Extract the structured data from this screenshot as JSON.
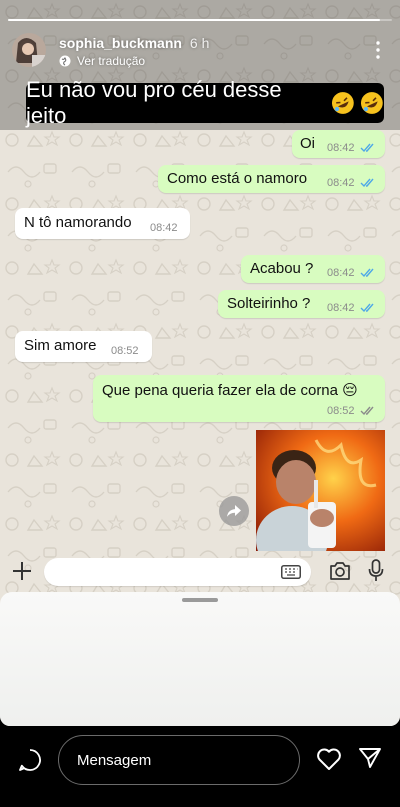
{
  "story": {
    "username": "sophia_buckmann",
    "time_ago": "6 h",
    "translate_label": "Ver tradução",
    "caption": "Eu não vou pro céu desse jeito",
    "progress": 0.97
  },
  "chat": {
    "messages": [
      {
        "text": "Oi",
        "time": "08:42",
        "side": "out",
        "status": "read"
      },
      {
        "text": "Como está o namoro",
        "time": "08:42",
        "side": "out",
        "status": "read"
      },
      {
        "text": "N tô namorando",
        "time": "08:42",
        "side": "in"
      },
      {
        "text": "Acabou ?",
        "time": "08:42",
        "side": "out",
        "status": "read"
      },
      {
        "text": "Solteirinho ?",
        "time": "08:42",
        "side": "out",
        "status": "read"
      },
      {
        "text": "Sim amore",
        "time": "08:52",
        "side": "in"
      },
      {
        "text": "Que pena queria fazer ela de corna 😔",
        "time": "08:52",
        "side": "out",
        "status": "delivered"
      }
    ]
  },
  "reply": {
    "placeholder": "Mensagem"
  },
  "colors": {
    "outgoing_bubble": "#d8fcc0",
    "incoming_bubble": "#ffffff",
    "read_ticks": "#4fa8e8",
    "caption_bg": "#000000"
  },
  "icons": [
    "globe-icon",
    "more-icon",
    "rofl-emoji",
    "double-check-icon",
    "forward-icon",
    "plus-icon",
    "keyboard-icon",
    "camera-icon",
    "mic-icon",
    "reply-circle-icon",
    "heart-icon",
    "send-icon"
  ]
}
